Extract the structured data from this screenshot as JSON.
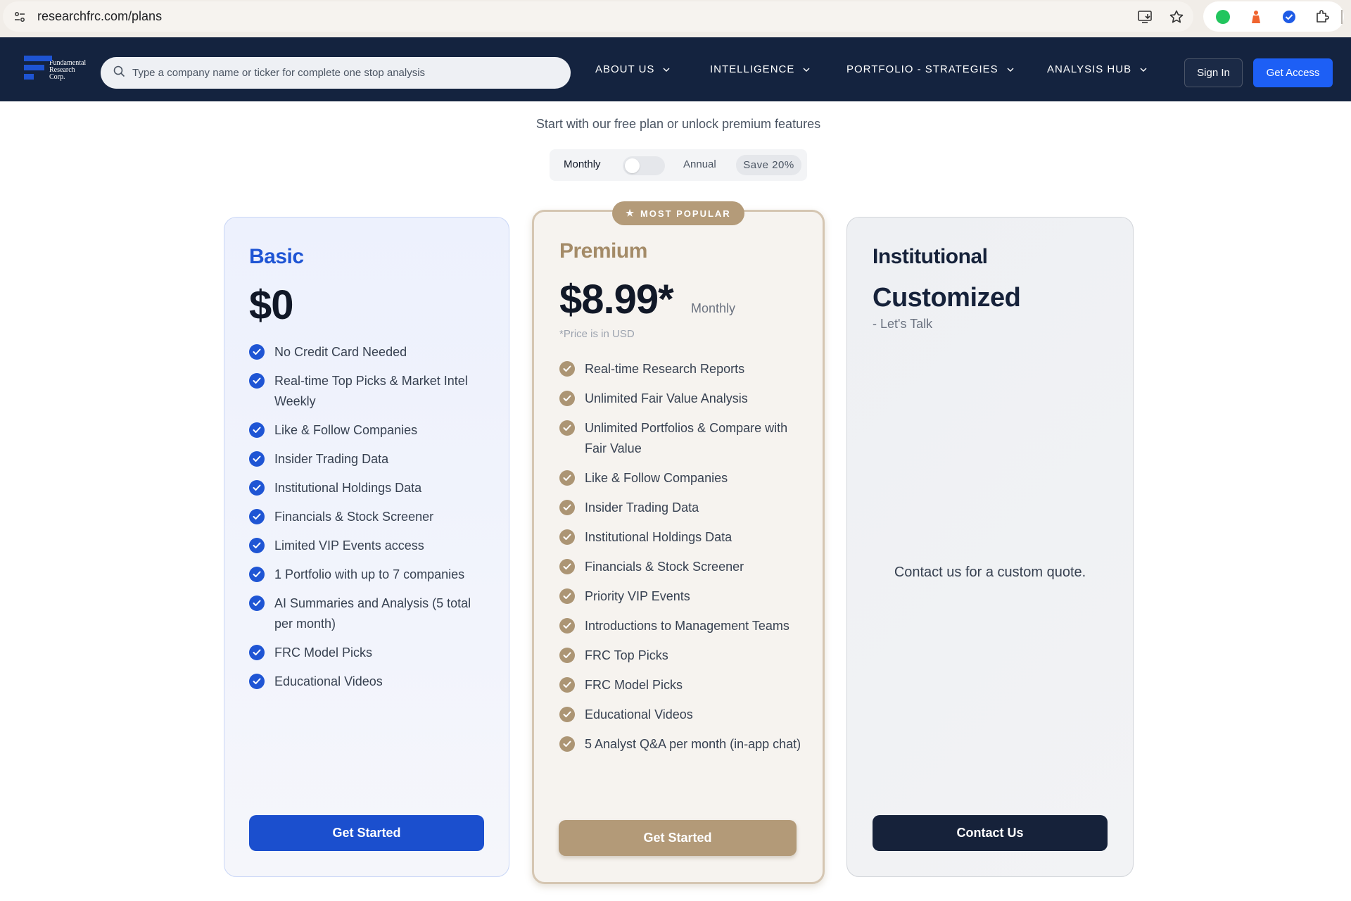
{
  "browser": {
    "url": "researchfrc.com/plans"
  },
  "nav": {
    "logo_lines": [
      "Fundamental",
      "Research",
      "Corp."
    ],
    "search_placeholder": "Type a company name or ticker for complete one stop analysis",
    "menu": [
      {
        "label": "ABOUT US"
      },
      {
        "label": "INTELLIGENCE"
      },
      {
        "label": "PORTFOLIO - STRATEGIES"
      },
      {
        "label": "ANALYSIS HUB"
      }
    ],
    "sign_in": "Sign In",
    "get_access": "Get Access"
  },
  "header": {
    "subtitle": "Start with our free plan or unlock premium features",
    "billing": {
      "monthly": "Monthly",
      "annual": "Annual",
      "save": "Save 20%",
      "annual_selected": false
    }
  },
  "plans": {
    "basic": {
      "name": "Basic",
      "price": "$0",
      "features": [
        "No Credit Card Needed",
        "Real-time Top Picks & Market Intel Weekly",
        "Like & Follow Companies",
        "Insider Trading Data",
        "Institutional Holdings Data",
        "Financials & Stock Screener",
        "Limited VIP Events access",
        "1 Portfolio with up to 7 companies",
        "AI Summaries and Analysis (5 total per month)",
        "FRC Model Picks",
        "Educational Videos"
      ],
      "cta": "Get Started"
    },
    "premium": {
      "badge": "MOST POPULAR",
      "name": "Premium",
      "price": "$8.99*",
      "period": "Monthly",
      "note": "*Price is in USD",
      "features": [
        "Real-time Research Reports",
        "Unlimited Fair Value Analysis",
        "Unlimited Portfolios & Compare with Fair Value",
        "Like & Follow Companies",
        "Insider Trading Data",
        "Institutional Holdings Data",
        "Financials & Stock Screener",
        "Priority VIP Events",
        "Introductions to Management Teams",
        "FRC Top Picks",
        "FRC Model Picks",
        "Educational Videos",
        "5 Analyst Q&A per month (in-app chat)"
      ],
      "cta": "Get Started"
    },
    "institutional": {
      "name": "Institutional",
      "price": "Customized",
      "tagline": "- Let's Talk",
      "message": "Contact us for a custom quote.",
      "cta": "Contact Us"
    }
  },
  "colors": {
    "nav_bg": "#14233f",
    "basic_accent": "#1f55d4",
    "premium_accent": "#ac9574",
    "institutional_accent": "#16223a",
    "cta_blue": "#1d5ff5"
  }
}
